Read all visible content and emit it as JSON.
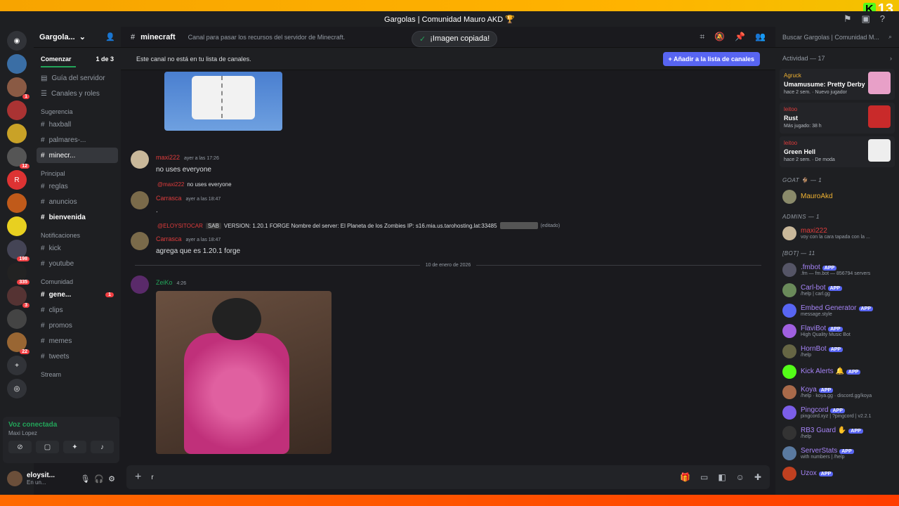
{
  "window": {
    "title": "Gargolas | Comunidad Mauro AKD 🏆",
    "kick_count": "13"
  },
  "server": {
    "name": "Gargola...",
    "onboarding": "Comenzar",
    "progress": "1 de 3"
  },
  "servers": [
    {
      "badge": "1"
    },
    {
      "badge": ""
    },
    {
      "badge": ""
    },
    {
      "badge": "12"
    },
    {
      "badge": ""
    },
    {
      "badge": ""
    },
    {
      "badge": ""
    },
    {
      "badge": "198"
    },
    {
      "badge": "335"
    },
    {
      "badge": "3"
    },
    {
      "badge": ""
    },
    {
      "badge": "22"
    }
  ],
  "channels": {
    "guide": "Guía del servidor",
    "roles": "Canales y roles",
    "cat_suggest": "Sugerencia",
    "haxball": "haxball",
    "palmares": "palmares-...",
    "minecraft": "minecr...",
    "cat_principal": "Principal",
    "reglas": "reglas",
    "anuncios": "anuncios",
    "bienvenida": "bienvenida",
    "cat_notif": "Notificaciones",
    "kick": "kick",
    "youtube": "youtube",
    "cat_comunidad": "Comunidad",
    "general": "gene...",
    "general_badge": "1",
    "clips": "clips",
    "promos": "promos",
    "memes": "memes",
    "tweets": "tweets",
    "cat_stream": "Stream"
  },
  "voice": {
    "status": "Voz conectada",
    "user": "Maxi Lopez"
  },
  "user": {
    "name": "eloysit...",
    "status": "En un..."
  },
  "header": {
    "channel": "minecraft",
    "topic": "Canal para pasar los recursos del servidor de Minecraft.",
    "toast": "¡Imagen copiada!",
    "search": "Buscar Gargolas | Comunidad M..."
  },
  "notice": {
    "text": "Este canal no está en tu lista de canales.",
    "button": "+ Añadir a la lista de canales"
  },
  "messages": {
    "m1_user": "maxi222",
    "m1_time": "ayer a las 17:26",
    "m1_text": "no uses everyone",
    "r1_user": "@maxi222",
    "r1_text": "no uses everyone",
    "m2_user": "Carrasca",
    "m2_time": "ayer a las 18:47",
    "m2_text": ".",
    "r2_user": "@ELOYSITOCAR",
    "r2_tag": "SAB",
    "r2_text": "VERSION: 1.20.1 FORGE Nombre del server: El Planeta de los Zombies IP: s16.mia.us.tarohosting.lat:33485",
    "r2_edited": "(editado)",
    "m3_user": "Carrasca",
    "m3_time": "ayer a las 18:47",
    "m3_text": "agrega que es 1.20.1 forge",
    "date": "10 de enero de 2026",
    "m4_user": "ZeiKo",
    "m4_time": "4:26"
  },
  "composer": {
    "text": "r"
  },
  "activity": {
    "title": "Actividad — 17",
    "cards": [
      {
        "user": "Agruck",
        "game": "Umamusume: Pretty Derby",
        "detail": "hace 2 sem. · Nuevo jugador"
      },
      {
        "user": "leitoo",
        "game": "Rust",
        "detail": "Más jugado: 38 h"
      },
      {
        "user": "leitoo",
        "game": "Green Hell",
        "detail": "hace 2 sem. · De moda"
      }
    ]
  },
  "members": {
    "goat_title": "GOAT 🐐 — 1",
    "goat": "MauroAkd",
    "admins_title": "ADMINS — 1",
    "admin": "maxi222",
    "admin_sub": "voy con la cara tapada con la ...",
    "bot_title": "[BOT] — 11",
    "bots": [
      {
        "name": ".fmbot",
        "sub": ".fm — fm.bot — 856794 servers"
      },
      {
        "name": "Carl-bot",
        "sub": "/help | carl.gg"
      },
      {
        "name": "Embed Generator",
        "sub": "message.style"
      },
      {
        "name": "FlaviBot",
        "sub": "High Quality Music Bot"
      },
      {
        "name": "HornBot",
        "sub": "/help"
      },
      {
        "name": "Kick Alerts 🔔",
        "sub": ""
      },
      {
        "name": "Koya",
        "sub": "/help · koya.gg · discord.gg/koya"
      },
      {
        "name": "Pingcord",
        "sub": "pingcord.xyz | ?pingcord | v2.2.1"
      },
      {
        "name": "RB3 Guard ✋",
        "sub": "/help"
      },
      {
        "name": "ServerStats",
        "sub": "with numbers | /help"
      },
      {
        "name": "Uzox",
        "sub": ""
      }
    ],
    "app_label": "APP"
  },
  "colors": {
    "accent": "#5865f2",
    "online": "#23a55a",
    "mention": "#f23f43"
  }
}
